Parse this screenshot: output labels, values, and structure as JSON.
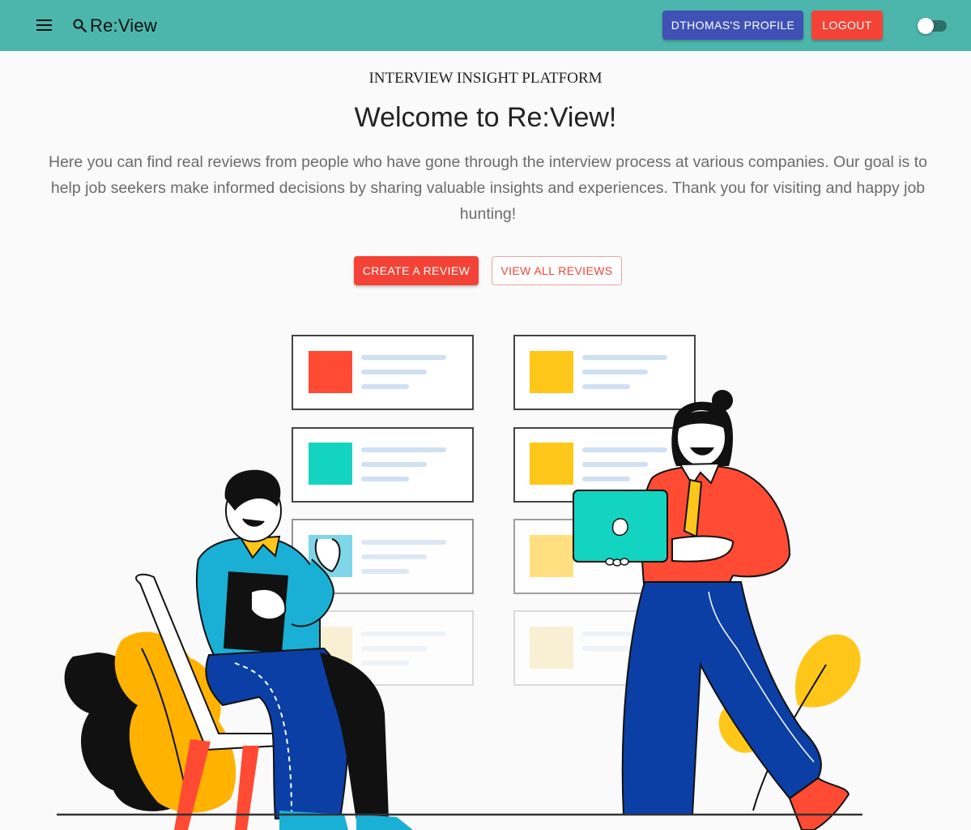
{
  "app": {
    "brand": "Re:View",
    "profile_button": "DTHOMAS'S PROFILE",
    "logout_button": "LOGOUT"
  },
  "hero": {
    "tagline": "INTERVIEW INSIGHT PLATFORM",
    "title": "Welcome to Re:View!",
    "intro": "Here you can find real reviews from people who have gone through the interview process at various companies. Our goal is to help job seekers make informed decisions by sharing valuable insights and experiences. Thank you for visiting and happy job hunting!",
    "create_button": "CREATE A REVIEW",
    "view_button": "VIEW ALL REVIEWS"
  },
  "theme": {
    "appbar": "#4db6ac",
    "primary": "#3f51b5",
    "accent": "#f44336",
    "dark_mode_enabled": false
  },
  "icons": {
    "menu": "menu-icon",
    "brand": "search-refresh-icon",
    "theme": "moon-icon"
  }
}
